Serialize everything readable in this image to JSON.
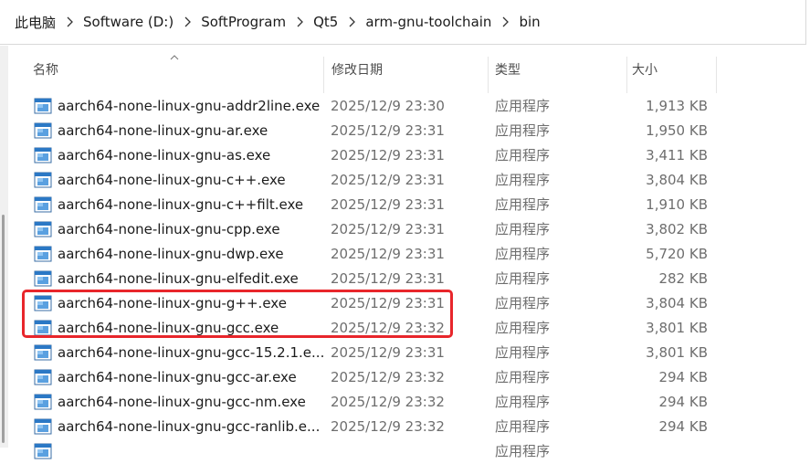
{
  "breadcrumb": [
    {
      "label": "此电脑"
    },
    {
      "label": "Software (D:)"
    },
    {
      "label": "SoftProgram"
    },
    {
      "label": "Qt5"
    },
    {
      "label": "arm-gnu-toolchain"
    },
    {
      "label": "bin"
    }
  ],
  "columns": {
    "name": "名称",
    "date": "修改日期",
    "type": "类型",
    "size": "大小"
  },
  "files": [
    {
      "name": "aarch64-none-linux-gnu-addr2line.exe",
      "date": "2025/12/9 23:30",
      "type": "应用程序",
      "size": "1,913 KB"
    },
    {
      "name": "aarch64-none-linux-gnu-ar.exe",
      "date": "2025/12/9 23:31",
      "type": "应用程序",
      "size": "1,950 KB"
    },
    {
      "name": "aarch64-none-linux-gnu-as.exe",
      "date": "2025/12/9 23:31",
      "type": "应用程序",
      "size": "3,411 KB"
    },
    {
      "name": "aarch64-none-linux-gnu-c++.exe",
      "date": "2025/12/9 23:31",
      "type": "应用程序",
      "size": "3,804 KB"
    },
    {
      "name": "aarch64-none-linux-gnu-c++filt.exe",
      "date": "2025/12/9 23:31",
      "type": "应用程序",
      "size": "1,910 KB"
    },
    {
      "name": "aarch64-none-linux-gnu-cpp.exe",
      "date": "2025/12/9 23:31",
      "type": "应用程序",
      "size": "3,802 KB"
    },
    {
      "name": "aarch64-none-linux-gnu-dwp.exe",
      "date": "2025/12/9 23:31",
      "type": "应用程序",
      "size": "5,720 KB"
    },
    {
      "name": "aarch64-none-linux-gnu-elfedit.exe",
      "date": "2025/12/9 23:31",
      "type": "应用程序",
      "size": "282 KB"
    },
    {
      "name": "aarch64-none-linux-gnu-g++.exe",
      "date": "2025/12/9 23:31",
      "type": "应用程序",
      "size": "3,804 KB"
    },
    {
      "name": "aarch64-none-linux-gnu-gcc.exe",
      "date": "2025/12/9 23:32",
      "type": "应用程序",
      "size": "3,801 KB"
    },
    {
      "name": "aarch64-none-linux-gnu-gcc-15.2.1.e...",
      "date": "2025/12/9 23:31",
      "type": "应用程序",
      "size": "3,801 KB"
    },
    {
      "name": "aarch64-none-linux-gnu-gcc-ar.exe",
      "date": "2025/12/9 23:32",
      "type": "应用程序",
      "size": "294 KB"
    },
    {
      "name": "aarch64-none-linux-gnu-gcc-nm.exe",
      "date": "2025/12/9 23:32",
      "type": "应用程序",
      "size": "294 KB"
    },
    {
      "name": "aarch64-none-linux-gnu-gcc-ranlib.e...",
      "date": "2025/12/9 23:32",
      "type": "应用程序",
      "size": "294 KB"
    },
    {
      "name": "",
      "date": "",
      "type": "应用程序",
      "size": ""
    }
  ],
  "colors": {
    "highlight": "#e8262b",
    "exe_icon_blue": "#2b78c5"
  },
  "icons": {
    "file": "exe-file-icon",
    "separator": "chevron-right-icon",
    "sort": "sort-up-icon"
  }
}
